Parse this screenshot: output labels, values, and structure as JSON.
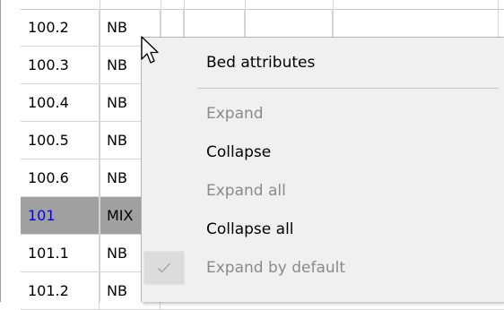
{
  "grid": {
    "rows": [
      {
        "id": "100.2",
        "type": "NB",
        "selected": false
      },
      {
        "id": "100.3",
        "type": "NB",
        "selected": false
      },
      {
        "id": "100.4",
        "type": "NB",
        "selected": false
      },
      {
        "id": "100.5",
        "type": "NB",
        "selected": false
      },
      {
        "id": "100.6",
        "type": "NB",
        "selected": false
      },
      {
        "id": "101",
        "type": "MIX",
        "selected": true
      },
      {
        "id": "101.1",
        "type": "NB",
        "selected": false
      },
      {
        "id": "101.2",
        "type": "NB",
        "selected": false
      }
    ]
  },
  "context_menu": {
    "items": [
      {
        "label": "Bed attributes",
        "enabled": true,
        "checked": false
      },
      {
        "label": "Expand",
        "enabled": false,
        "checked": false
      },
      {
        "label": "Collapse",
        "enabled": true,
        "checked": false
      },
      {
        "label": "Expand all",
        "enabled": false,
        "checked": false
      },
      {
        "label": "Collapse all",
        "enabled": true,
        "checked": false
      },
      {
        "label": "Expand by default",
        "enabled": false,
        "checked": true
      }
    ]
  },
  "colors": {
    "selected_row_bg": "#a0a0a0",
    "selected_row_id_text": "#0000ee",
    "menu_bg": "#f0f0f0",
    "disabled_text": "#8a8a8a"
  },
  "icons": {
    "cursor": "arrow-cursor-icon",
    "check": "checkmark-icon"
  }
}
